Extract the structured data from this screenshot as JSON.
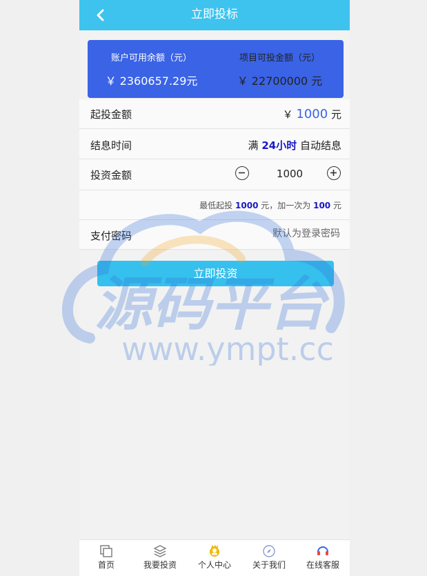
{
  "header": {
    "title": "立即投标"
  },
  "balance": {
    "available_label": "账户可用余额（元）",
    "available_value": "￥ 2360657.29元",
    "investable_label": "项目可投金额（元）",
    "investable_value": "￥ 22700000 元"
  },
  "form": {
    "min_invest_label": "起投金额",
    "min_invest_currency": "￥",
    "min_invest_value": "1000",
    "min_invest_unit": "元",
    "settle_label": "结息时间",
    "settle_prefix": "满",
    "settle_bold": "24小时",
    "settle_suffix": "自动结息",
    "amount_label": "投资金额",
    "amount_value": "1000",
    "hint_prefix": "最低起投",
    "hint_min": "1000",
    "hint_mid": "元，加一次为",
    "hint_step": "100",
    "hint_suffix": "元",
    "pwd_label": "支付密码",
    "pwd_placeholder": "默认为登录密码",
    "submit_label": "立即投资"
  },
  "watermark": {
    "text_cn": "源码平台",
    "text_url": "www.ympt.cc"
  },
  "tabbar": {
    "items": [
      {
        "label": "首页",
        "icon": "home-icon"
      },
      {
        "label": "我要投资",
        "icon": "layers-icon"
      },
      {
        "label": "个人中心",
        "icon": "user-center-icon"
      },
      {
        "label": "关于我们",
        "icon": "compass-icon"
      },
      {
        "label": "在线客服",
        "icon": "headset-icon"
      }
    ]
  },
  "colors": {
    "header": "#3ec3ee",
    "card": "#3a63e6",
    "button": "#36c0ed"
  }
}
